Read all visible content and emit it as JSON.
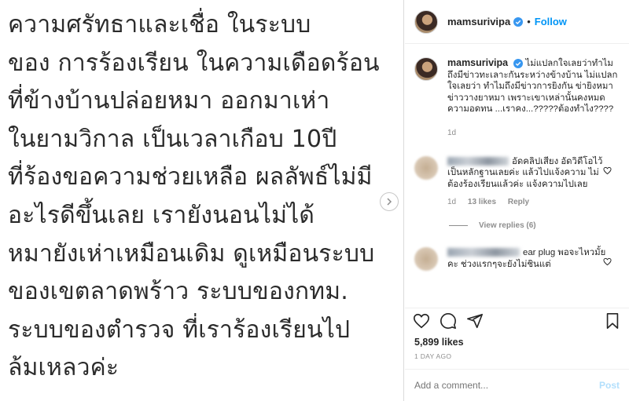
{
  "post_image": {
    "text_lines": [
      "ความศรัทธาและเชื่อ ในระบบ",
      "ของ การร้องเรียน ในความเดือดร้อน",
      "ที่ข้างบ้านปล่อยหมา ออกมาเห่า",
      "ในยามวิกาล เป็นเวลาเกือบ 10ปี",
      "ที่ร้องขอความช่วยเหลือ ผลลัพธ์ไม่มี",
      "อะไรดีขึ้นเลย เรายังนอนไม่ได้",
      "หมายังเห่าเหมือนเดิม ดูเหมือนระบบ",
      "ของเขตลาดพร้าว ระบบของกทม.",
      "ระบบของตำรวจ ที่เราร้องเรียนไป",
      "ล้มเหลวค่ะ"
    ]
  },
  "header": {
    "username": "mamsurivipa",
    "dot": "•",
    "follow_label": "Follow"
  },
  "caption": {
    "username": "mamsurivipa",
    "text": "ไม่แปลกใจเลยว่าทำไมถึงมีข่าวทะเลาะกันระหว่างข้างบ้าน ไม่แปลกใจเลยว่า ทำไมถึงมีข่าวการยิงกัน ข่ายิงหมา ข่าววางยาหมา เพราะเขาเหล่านั้นคงหมดความอดทน ...เราคง...?????ต้องทำไง????",
    "time": "1d"
  },
  "comments": [
    {
      "text": "อัดคลิปเสียง อัดวิดีโอไว้เป็นหลักฐานเลยค่ะ แล้วไปแจ้งความ ไม่ต้องร้องเรียนแล้วค่ะ แจ้งความไปเลย",
      "time": "1d",
      "likes": "13 likes",
      "reply_label": "Reply",
      "view_replies": "View replies (6)"
    },
    {
      "text": "ear plug พอจะไหวมั้ยคะ ช่วงแรกๆจะยังไม่ชินแต่"
    }
  ],
  "actions": {
    "likes": "5,899 likes",
    "time_ago": "1 DAY AGO"
  },
  "add_comment": {
    "placeholder": "Add a comment...",
    "post_label": "Post"
  },
  "colors": {
    "accent": "#0095f6",
    "post_disabled": "#b2dffc",
    "muted": "#8e8e8e"
  }
}
